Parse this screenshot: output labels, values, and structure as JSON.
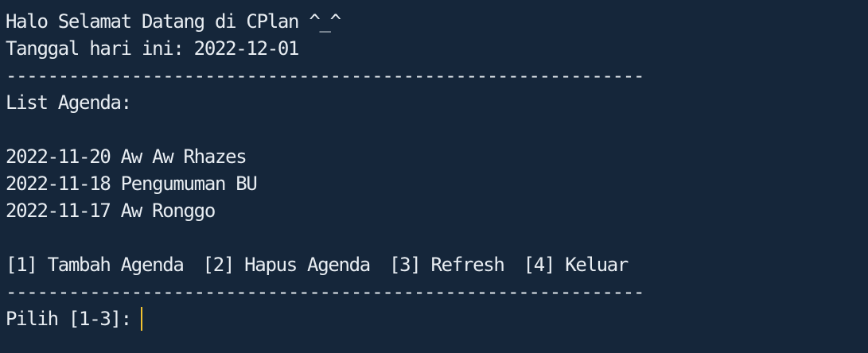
{
  "header": {
    "welcome": "Halo Selamat Datang di CPlan ^_^",
    "date_line": "Tanggal hari ini: 2022-12-01"
  },
  "separator": "-------------------------------------------------------------",
  "agenda": {
    "title": "List Agenda:",
    "items": [
      "2022-11-20 Aw Aw Rhazes",
      "2022-11-18 Pengumuman BU",
      "2022-11-17 Aw Ronggo"
    ]
  },
  "menu": {
    "options": [
      "[1] Tambah Agenda",
      "[2] Hapus Agenda",
      "[3] Refresh",
      "[4] Keluar"
    ]
  },
  "prompt": {
    "label": "Pilih [1-3]:",
    "value": ""
  },
  "colors": {
    "background": "#15263a",
    "text": "#e8edf2",
    "cursor": "#f2c230"
  }
}
